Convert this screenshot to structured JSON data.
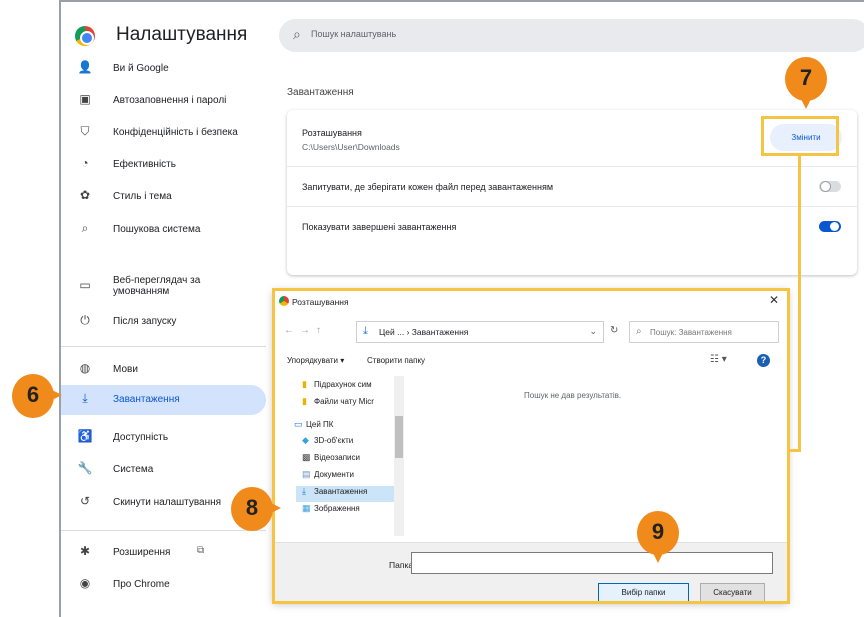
{
  "app": {
    "title": "Налаштування"
  },
  "search": {
    "placeholder": "Пошук налаштувань"
  },
  "sidebar": {
    "items": [
      {
        "label": "Ви й Google",
        "icon": "person-icon"
      },
      {
        "label": "Автозаповнення і паролі",
        "icon": "clipboard-icon"
      },
      {
        "label": "Конфіденційність і безпека",
        "icon": "shield-icon"
      },
      {
        "label": "Ефективність",
        "icon": "speed-icon"
      },
      {
        "label": "Стиль і тема",
        "icon": "palette-icon"
      },
      {
        "label": "Пошукова система",
        "icon": "search-icon"
      },
      {
        "label": "Веб-переглядач за умовчанням",
        "icon": "browser-icon"
      },
      {
        "label": "Після запуску",
        "icon": "power-icon"
      },
      {
        "label": "Мови",
        "icon": "globe-icon"
      },
      {
        "label": "Завантаження",
        "icon": "download-icon"
      },
      {
        "label": "Доступність",
        "icon": "accessibility-icon"
      },
      {
        "label": "Система",
        "icon": "wrench-icon"
      },
      {
        "label": "Скинути налаштування",
        "icon": "reset-icon"
      },
      {
        "label": "Розширення",
        "icon": "puzzle-icon"
      },
      {
        "label": "Про Chrome",
        "icon": "chrome-icon"
      }
    ]
  },
  "downloads": {
    "section_title": "Завантаження",
    "location_label": "Розташування",
    "location_path": "C:\\Users\\User\\Downloads",
    "change_button": "Змінити",
    "ask_label": "Запитувати, де зберігати кожен файл перед завантаженням",
    "ask_enabled": false,
    "show_label": "Показувати завершені завантаження",
    "show_enabled": true
  },
  "dialog": {
    "title": "Розташування",
    "address": "Цей ... › Завантаження",
    "search_placeholder": "Пошук: Завантаження",
    "organize": "Упорядкувати ▾",
    "new_folder": "Створити папку",
    "empty_message": "Пошук не дав результатів.",
    "tree": [
      {
        "label": "Підрахунок сим",
        "icon": "folder-icon"
      },
      {
        "label": "Файли чату Micr",
        "icon": "folder-icon"
      },
      {
        "label": "Цей ПК",
        "icon": "pc-icon"
      },
      {
        "label": "3D-об'єкти",
        "icon": "cube-icon"
      },
      {
        "label": "Відеозаписи",
        "icon": "video-icon"
      },
      {
        "label": "Документи",
        "icon": "document-icon"
      },
      {
        "label": "Завантаження",
        "icon": "download-icon"
      },
      {
        "label": "Зображення",
        "icon": "image-icon"
      }
    ],
    "folder_label": "Папка:",
    "folder_value": "",
    "select_button": "Вибір папки",
    "cancel_button": "Скасувати"
  },
  "markers": {
    "m6": "6",
    "m7": "7",
    "m8": "8",
    "m9": "9"
  }
}
